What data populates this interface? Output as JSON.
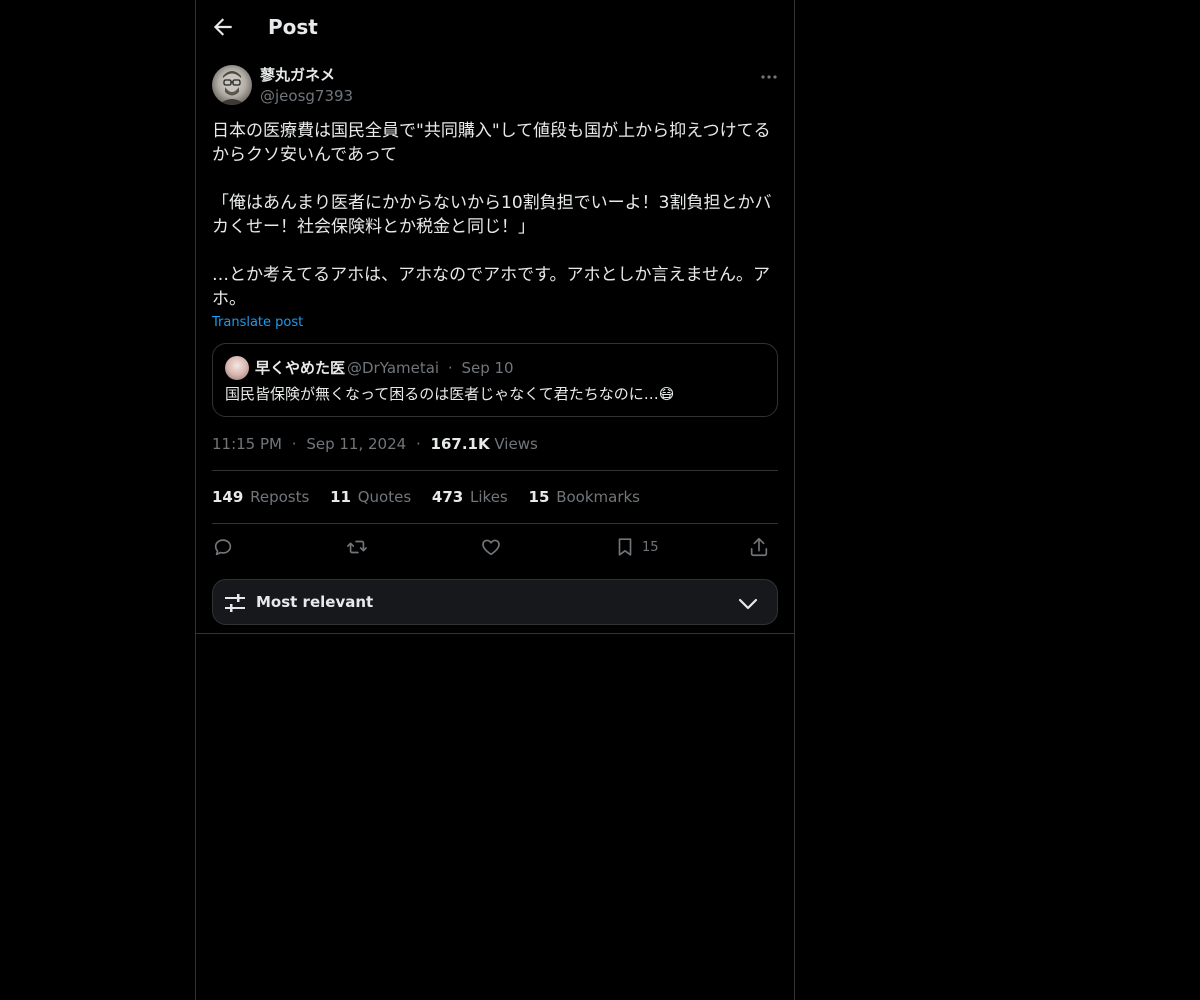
{
  "header": {
    "title": "Post"
  },
  "author": {
    "name": "蓼丸ガネメ",
    "handle": "@jeosg7393"
  },
  "post": {
    "text": "日本の医療費は国民全員で\"共同購入\"して値段も国が上から抑えつけてる\nからクソ安いんであって\n\n「俺はあんまり医者にかからないから10割負担でいーよ！3割負担とかバ\nカくせー！社会保険料とか税金と同じ！」\n\n…とか考えてるアホは、アホなのでアホです。アホとしか言えません。ア\nホ。",
    "translate_label": "Translate post"
  },
  "quote": {
    "name": "早くやめた医",
    "handle": "@DrYametai",
    "separator": "·",
    "date": "Sep 10",
    "text": "国民皆保険が無くなって困るのは医者じゃなくて君たちなのに…😷"
  },
  "meta": {
    "time": "11:15 PM",
    "separator": "·",
    "date": "Sep 11, 2024",
    "views_count": "167.1K",
    "views_label": "Views"
  },
  "stats": [
    {
      "count": "149",
      "label": "Reposts"
    },
    {
      "count": "11",
      "label": "Quotes"
    },
    {
      "count": "473",
      "label": "Likes"
    },
    {
      "count": "15",
      "label": "Bookmarks"
    }
  ],
  "actions": {
    "bookmark_count": "15"
  },
  "icons": {
    "back": "arrow-left-icon",
    "more": "more-horizontal-icon",
    "reply": "reply-icon",
    "repost": "repost-icon",
    "like": "heart-icon",
    "bookmark": "bookmark-icon",
    "share": "share-icon",
    "sort": "sliders-icon",
    "chevron": "chevron-down-icon"
  },
  "sort": {
    "label": "Most relevant"
  },
  "colors": {
    "background": "#000000",
    "text": "#e7e9ea",
    "muted": "#71767b",
    "accent": "#1d9bf0",
    "border": "#2f3336"
  }
}
